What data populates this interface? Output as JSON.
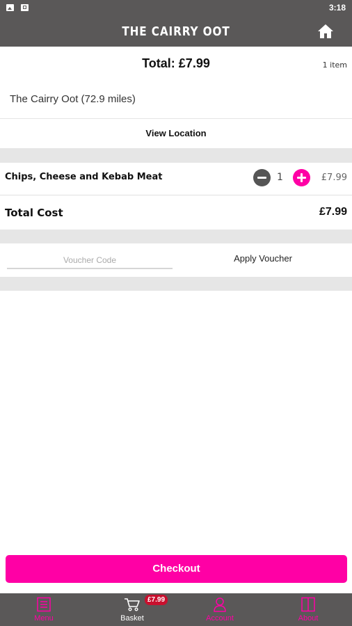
{
  "status_bar": {
    "time": "3:18"
  },
  "header": {
    "title": "THE CAIRRY OOT"
  },
  "summary": {
    "total": "Total: £7.99",
    "item_count": "1 item"
  },
  "shop": {
    "name_distance": "The Cairry Oot (72.9 miles)",
    "view_location": "View Location"
  },
  "basket": {
    "items": [
      {
        "name": "Chips, Cheese and Kebab Meat",
        "quantity": "1",
        "price": "£7.99"
      }
    ],
    "total_label": "Total Cost",
    "total_value": "£7.99"
  },
  "voucher": {
    "placeholder": "Voucher Code",
    "value": "",
    "apply_label": "Apply Voucher"
  },
  "checkout_label": "Checkout",
  "tabs": [
    {
      "label": "Menu",
      "icon": "menu-book-icon",
      "active": false
    },
    {
      "label": "Basket",
      "icon": "cart-icon",
      "active": true,
      "badge": "£7.99"
    },
    {
      "label": "Account",
      "icon": "person-icon",
      "active": false
    },
    {
      "label": "About",
      "icon": "info-book-icon",
      "active": false
    }
  ],
  "colors": {
    "accent": "#ff00a5",
    "bar": "#5a5858",
    "badge": "#c8102e"
  }
}
